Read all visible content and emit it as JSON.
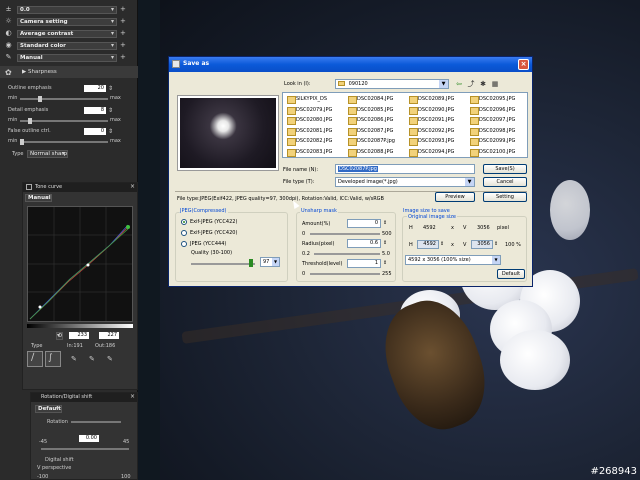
{
  "left_panel": {
    "rows": [
      {
        "icon": "plus-minus-icon",
        "glyph": "±",
        "value": "0.0"
      },
      {
        "icon": "sun-icon",
        "glyph": "☼",
        "value": "Camera setting"
      },
      {
        "icon": "contrast-icon",
        "glyph": "◐",
        "value": "Average contrast"
      },
      {
        "icon": "color-icon",
        "glyph": "◉",
        "value": "Standard color"
      },
      {
        "icon": "manual-icon",
        "glyph": "✎",
        "value": "Manual"
      }
    ],
    "sharpness_header": "Sharpness",
    "outline_emphasis": {
      "label": "Outline emphasis",
      "value": "20",
      "min": "min",
      "max": "max"
    },
    "detail_emphasis": {
      "label": "Detail emphasis",
      "value": "8",
      "min": "min",
      "max": "max"
    },
    "false_outline": {
      "label": "False outline ctrl.",
      "value": "0",
      "min": "min",
      "max": "max"
    },
    "type_label": "Type",
    "type_value": "Normal sharp"
  },
  "tone_curve": {
    "title": "Tone curve",
    "mode": "Manual",
    "channel": "0",
    "in_value": "233",
    "out_value": "227",
    "type_label": "Type",
    "in_label": "In:191",
    "out_label": "Out:186",
    "rotation_title": "Rotation/Digital shift",
    "rotation_mode": "Default",
    "rotation_label": "Rotation",
    "rotation_value": "0.00",
    "rotation_min": "-45",
    "rotation_max": "45",
    "digital_shift": "Digital shift",
    "v_perspective": "V perspective",
    "bottom_min": "-100",
    "bottom_max": "100"
  },
  "dialog": {
    "title": "Save as",
    "look_in_label": "Look in (I):",
    "look_in_value": "090120",
    "files_col1": [
      "SILKYPIX_DS",
      "DSC02079.JPG",
      "DSC02080.JPG",
      "DSC02081.JPG",
      "DSC02082.JPG",
      "DSC02083.JPG"
    ],
    "files_col2": [
      "DSC02084.JPG",
      "DSC02085.JPG",
      "DSC02086.JPG",
      "DSC02087.JPG",
      "DSC02087P.jpg",
      "DSC02088.JPG"
    ],
    "files_col3": [
      "DSC02089.JPG",
      "DSC02090.JPG",
      "DSC02091.JPG",
      "DSC02092.JPG",
      "DSC02093.JPG",
      "DSC02094.JPG"
    ],
    "files_col4": [
      "DSC02095.JPG",
      "DSC02096.JPG",
      "DSC02097.JPG",
      "DSC02098.JPG",
      "DSC02099.JPG",
      "DSC02100.JPG"
    ],
    "file_name_label": "File name (N):",
    "file_name_value": "DSC02087P.jpg",
    "file_type_label": "File type (T):",
    "file_type_value": "Developed image(*.jpg)",
    "save_button": "Save(S)",
    "cancel_button": "Cancel",
    "info_text": "File type:JPEG(Exif422, JPEG quality=97, 300dpi), Rotation:Valid, ICC:Valid, w/sRGB",
    "preview_button": "Preview",
    "setting_button": "Setting",
    "jpeg_group": "JPEG(Compressed)",
    "radio1": "Exif-JPEG  (YCC422)",
    "radio2": "Exif-JPEG  (YCC420)",
    "radio3": "JPEG  (YCC444)",
    "quality_label": "Quality (30-100)",
    "quality_value": "97",
    "unsharp_group": "Unsharp mask",
    "amount_label": "Amount(%)",
    "amount_value": "0",
    "amount_min": "0",
    "amount_max": "500",
    "radius_label": "Radius(pixel)",
    "radius_value": "0.6",
    "radius_min": "0.2",
    "radius_max": "5.0",
    "threshold_label": "Threshold(level)",
    "threshold_value": "1",
    "threshold_min": "0",
    "threshold_max": "255",
    "size_group": "Image size to save",
    "original_label": "Original image size",
    "h_label": "H",
    "orig_h": "4592",
    "x_label": "x",
    "v_label": "V",
    "orig_v": "3056",
    "pixel_label": "pixel",
    "new_h": "4592",
    "new_v": "3056",
    "percent": "100 %",
    "size_select": "4592 x 3056 (100% size)",
    "default_button": "Default"
  },
  "watermark": "#268943"
}
